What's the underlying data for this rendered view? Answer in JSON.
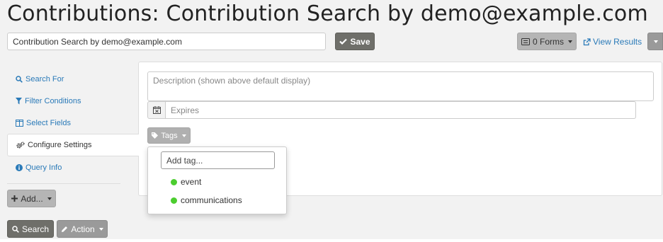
{
  "header": {
    "title": "Contributions: Contribution Search by demo@example.com"
  },
  "toolbar": {
    "title_value": "Contribution Search by demo@example.com",
    "save_label": "Save",
    "forms_label": "0 Forms",
    "view_results_label": "View Results"
  },
  "sidebar": {
    "items": [
      {
        "label": "Search For",
        "icon": "search-icon"
      },
      {
        "label": "Filter Conditions",
        "icon": "filter-icon"
      },
      {
        "label": "Select Fields",
        "icon": "columns-icon"
      },
      {
        "label": "Configure Settings",
        "icon": "gears-icon",
        "active": true
      },
      {
        "label": "Query Info",
        "icon": "info-icon"
      }
    ],
    "add_label": "Add..."
  },
  "settings": {
    "description_placeholder": "Description (shown above default display)",
    "expires_placeholder": "Expires",
    "tags_label": "Tags",
    "tag_search_placeholder": "Add tag...",
    "tags": [
      {
        "label": "event",
        "color": "#4ccd2f"
      },
      {
        "label": "communications",
        "color": "#4ccd2f"
      }
    ]
  },
  "footer": {
    "search_label": "Search",
    "action_label": "Action"
  },
  "colors": {
    "link": "#2a7ab8",
    "dark_button": "#6f6f6a",
    "grey_button": "#b5b5b5",
    "tag_dot": "#4ccd2f"
  }
}
